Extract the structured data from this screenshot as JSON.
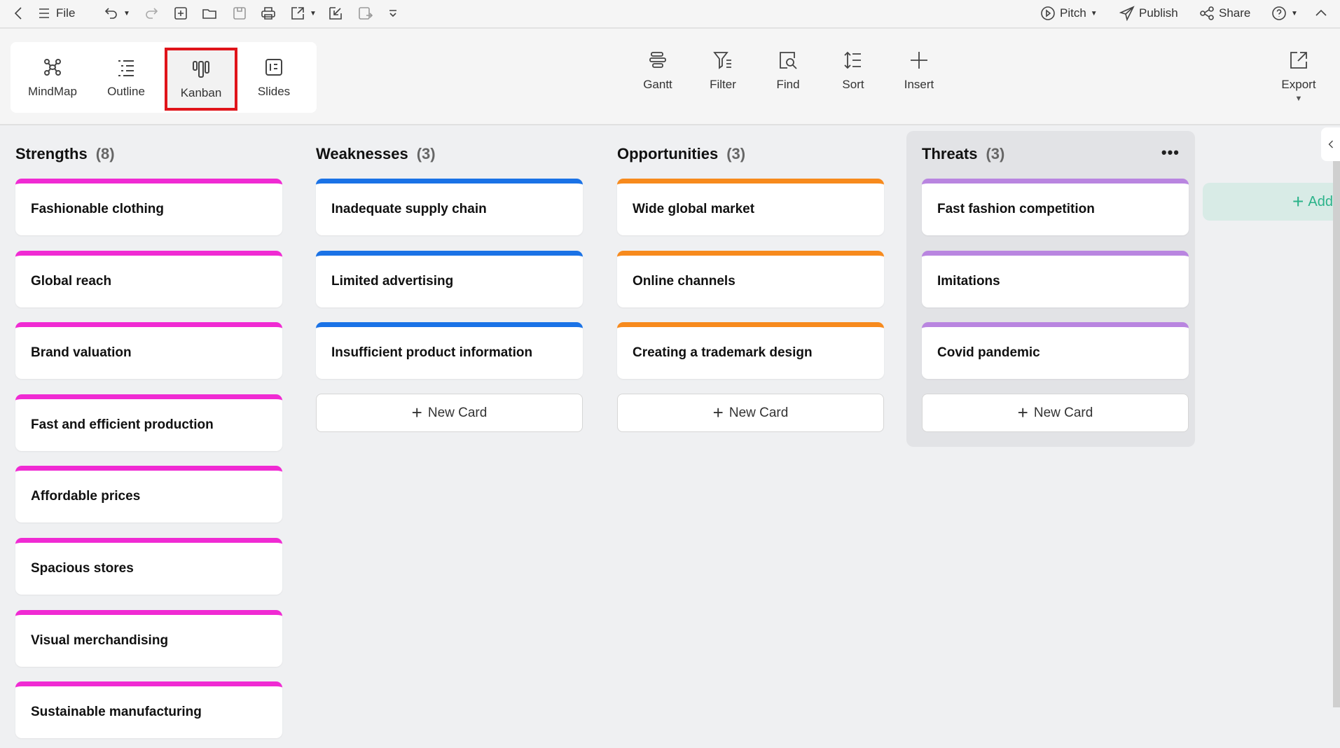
{
  "topbar": {
    "file": "File",
    "pitch": "Pitch",
    "publish": "Publish",
    "share": "Share"
  },
  "views": [
    {
      "label": "MindMap"
    },
    {
      "label": "Outline"
    },
    {
      "label": "Kanban",
      "active": true
    },
    {
      "label": "Slides"
    }
  ],
  "tools": [
    {
      "label": "Gantt"
    },
    {
      "label": "Filter"
    },
    {
      "label": "Find"
    },
    {
      "label": "Sort"
    },
    {
      "label": "Insert"
    }
  ],
  "export": "Export",
  "board": {
    "new_card": "New Card",
    "add_column": "Add",
    "columns": [
      {
        "title": "Strengths",
        "count": "(8)",
        "color": "#f02ad3",
        "cards": [
          "Fashionable clothing",
          "Global reach",
          "Brand valuation",
          "Fast and efficient production",
          "Affordable prices",
          "Spacious stores",
          "Visual merchandising",
          "Sustainable manufacturing"
        ]
      },
      {
        "title": "Weaknesses",
        "count": "(3)",
        "color": "#1a72e6",
        "cards": [
          "Inadequate supply chain",
          "Limited advertising",
          "Insufficient product information"
        ]
      },
      {
        "title": "Opportunities",
        "count": "(3)",
        "color": "#f78a1d",
        "cards": [
          "Wide global market",
          "Online channels",
          "Creating a trademark design"
        ]
      },
      {
        "title": "Threats",
        "count": "(3)",
        "color": "#b985e0",
        "cards": [
          "Fast fashion competition",
          "Imitations",
          "Covid pandemic"
        ],
        "highlighted": true
      }
    ]
  }
}
